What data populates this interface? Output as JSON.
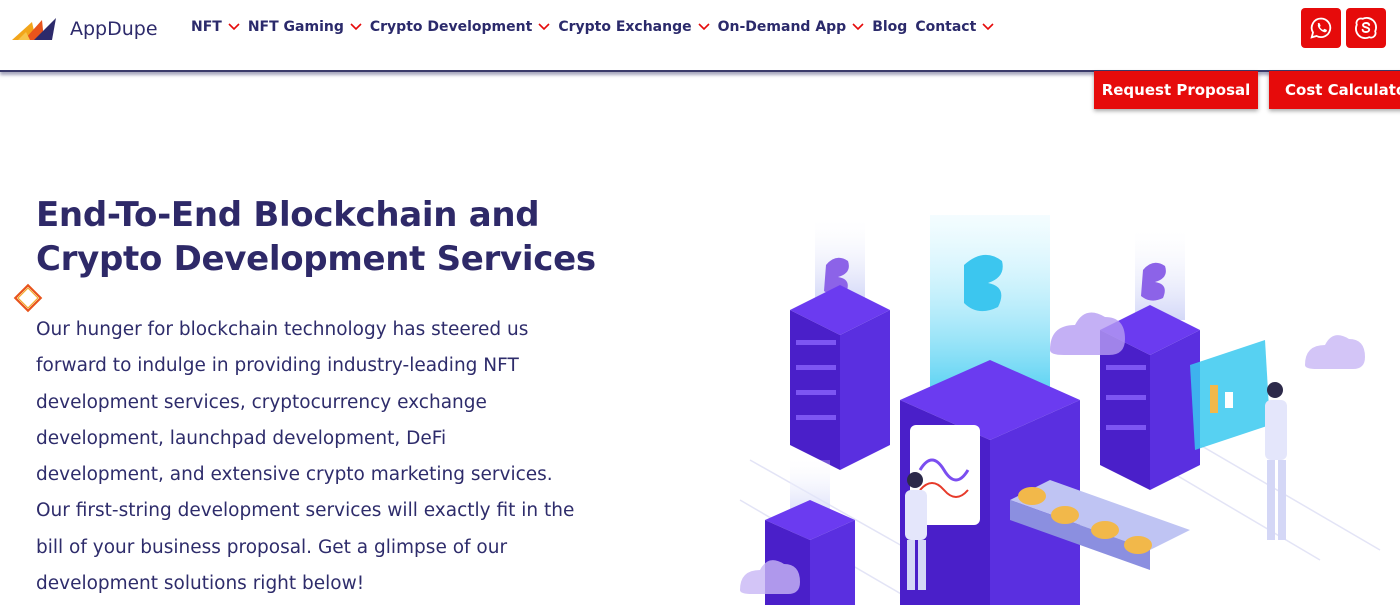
{
  "brand": {
    "name": "AppDupe",
    "accent": "#e60b0b",
    "primary_text": "#2e2968"
  },
  "nav": {
    "items": [
      {
        "label": "NFT",
        "has_dropdown": true
      },
      {
        "label": "NFT Gaming",
        "has_dropdown": true
      },
      {
        "label": "Crypto Development",
        "has_dropdown": true
      },
      {
        "label": "Crypto Exchange",
        "has_dropdown": true
      },
      {
        "label": "On-Demand App",
        "has_dropdown": true
      },
      {
        "label": "Blog",
        "has_dropdown": false
      },
      {
        "label": "Contact",
        "has_dropdown": true
      }
    ]
  },
  "social": {
    "icons": [
      "whatsapp-icon",
      "skype-icon"
    ]
  },
  "cta": {
    "request_proposal": "Request Proposal",
    "cost_calculator": "Cost Calculator"
  },
  "hero": {
    "title_lines": [
      "End-To-End Blockchain and",
      "Crypto Development Services"
    ],
    "description_lines": [
      "Our hunger for blockchain technology has steered us",
      "forward to indulge in providing industry-leading NFT",
      "development services, cryptocurrency exchange",
      "development, launchpad development, DeFi",
      "development, and extensive crypto marketing services.",
      "Our first-string development services will exactly fit in the",
      "bill of your business proposal. Get a glimpse of our",
      "development solutions right below!"
    ]
  }
}
